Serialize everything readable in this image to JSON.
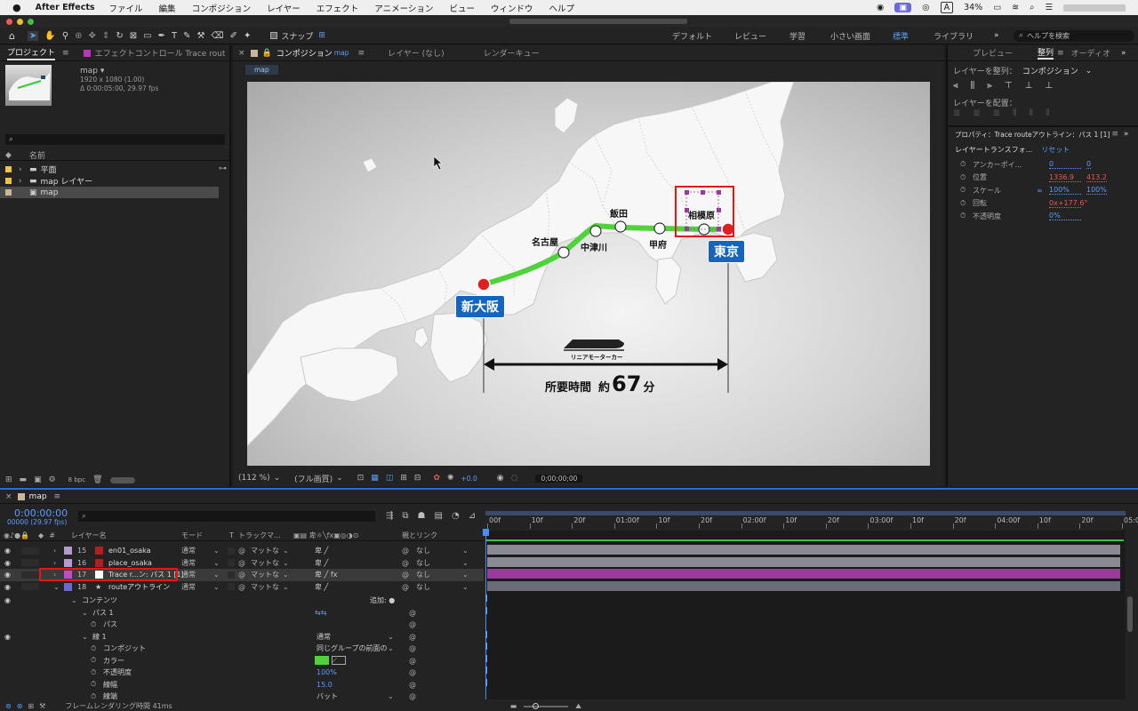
{
  "menubar": {
    "app": "After Effects",
    "items": [
      "ファイル",
      "編集",
      "コンポジション",
      "レイヤー",
      "エフェクト",
      "アニメーション",
      "ビュー",
      "ウィンドウ",
      "ヘルプ"
    ],
    "battery": "34%",
    "ime": "A"
  },
  "toolbar": {
    "snap_label": "スナップ",
    "workspaces": [
      "デフォルト",
      "レビュー",
      "学習",
      "小さい画面",
      "標準",
      "ライブラリ"
    ],
    "active_workspace": "標準",
    "search_placeholder": "ヘルプを検索"
  },
  "project": {
    "tab_project": "プロジェクト",
    "tab_effect": "エフェクトコントロール Trace rout",
    "comp_name": "map ▾",
    "comp_info1": "1920 x 1080 (1.00)",
    "comp_info2": "Δ 0:00:05:00, 29.97 fps",
    "col_name": "名前",
    "items": [
      {
        "name": "平面",
        "color": "#e8c542",
        "type": "folder"
      },
      {
        "name": "map レイヤー",
        "color": "#e8c542",
        "type": "folder"
      },
      {
        "name": "map",
        "color": "#c8b89a",
        "type": "comp"
      }
    ],
    "bpc": "8 bpc"
  },
  "comp_panel": {
    "tab_comp": "コンポジション",
    "tab_comp_name": "map",
    "tab_layer": "レイヤー (なし)",
    "tab_render": "レンダーキュー",
    "breadcrumb": "map",
    "zoom": "(112 %)",
    "quality": "(フル画質)",
    "exposure": "+0.0",
    "timecode": "0;00;00;00"
  },
  "map": {
    "stations": [
      "名古屋",
      "飯田",
      "中津川",
      "甲府",
      "相模原"
    ],
    "tokyo": "東京",
    "osaka": "新大阪",
    "train_label": "リニアモーターカー",
    "time_prefix": "所要時間",
    "time_approx": "約",
    "time_value": "67",
    "time_unit": "分"
  },
  "right_panel": {
    "tab_preview": "プレビュー",
    "tab_align": "整列",
    "tab_audio": "オーディオ",
    "align_label": "レイヤーを整列：",
    "align_target": "コンポジション",
    "distribute_label": "レイヤーを配置：",
    "props_title": "プロパティ：Trace routeアウトライン：パス 1 [1]",
    "transform_label": "レイヤートランスフォ...",
    "reset": "リセット",
    "props": [
      {
        "name": "アンカーポイ...",
        "v1": "0",
        "v2": "0",
        "c": "blue"
      },
      {
        "name": "位置",
        "v1": "1336.9",
        "v2": "413.2",
        "c": "red"
      },
      {
        "name": "スケール",
        "v1": "100%",
        "v2": "100%",
        "c": "blue"
      },
      {
        "name": "回転",
        "v1": "0x+177.6°",
        "v2": "",
        "c": "red"
      },
      {
        "name": "不透明度",
        "v1": "0%",
        "v2": "",
        "c": "blue"
      }
    ]
  },
  "timeline": {
    "tab": "map",
    "timecode": "0:00:00:00",
    "fps": "00000 (29.97 fps)",
    "col_layer": "レイヤー名",
    "col_mode": "モード",
    "col_t": "T",
    "col_track": "トラックマ...",
    "col_parent": "親とリンク",
    "ruler": [
      "00f",
      "10f",
      "20f",
      "01:00f",
      "10f",
      "20f",
      "02:00f",
      "10f",
      "20f",
      "03:00f",
      "10f",
      "20f",
      "04:00f",
      "10f",
      "20f",
      "05:0"
    ],
    "layers": [
      {
        "num": "15",
        "name": "en01_osaka",
        "color": "#b49ad0",
        "mode": "通常",
        "track": "マットな",
        "parent": "なし",
        "bar": "#8a8a92"
      },
      {
        "num": "16",
        "name": "place_osaka",
        "color": "#b49ad0",
        "mode": "通常",
        "track": "マットな",
        "parent": "なし",
        "bar": "#8a8a92"
      },
      {
        "num": "17",
        "name": "Trace r...ン: パス 1 [1]",
        "color": "#c24ac2",
        "mode": "通常",
        "track": "マットな",
        "parent": "なし",
        "bar": "#9b3a9b"
      },
      {
        "num": "18",
        "name": "routeアウトライン",
        "color": "#6a6ad0",
        "mode": "通常",
        "track": "マットな",
        "parent": "なし",
        "bar": "#6c6c78"
      }
    ],
    "tree": [
      {
        "label": "コンテンツ",
        "indent": 0,
        "extra": "追加: ●"
      },
      {
        "label": "パス 1",
        "indent": 1,
        "extra": ""
      },
      {
        "label": "パス",
        "indent": 2,
        "extra": ""
      },
      {
        "label": "線 1",
        "indent": 1,
        "extra": "通常"
      },
      {
        "label": "コンポジット",
        "indent": 2,
        "extra": "同じグループの前面の"
      },
      {
        "label": "カラー",
        "indent": 2,
        "extra": ""
      },
      {
        "label": "不透明度",
        "indent": 2,
        "extra": "100%"
      },
      {
        "label": "線幅",
        "indent": 2,
        "extra": "15.0"
      },
      {
        "label": "線端",
        "indent": 2,
        "extra": "バット"
      }
    ],
    "footer": "フレームレンダリング時間 41ms"
  }
}
